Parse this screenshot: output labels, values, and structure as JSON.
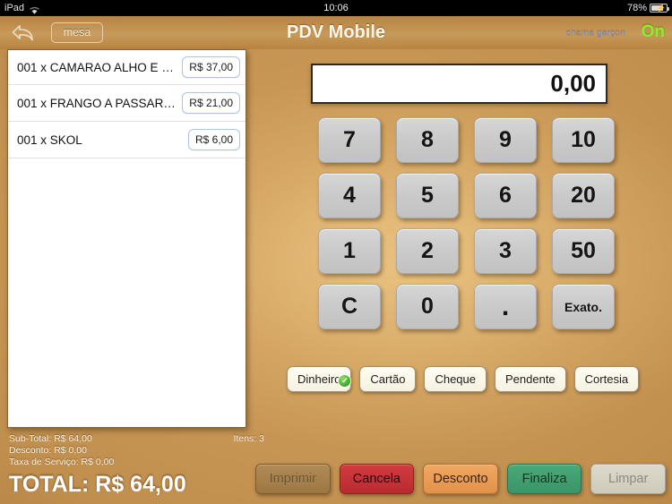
{
  "status_bar": {
    "device": "iPad",
    "wifi_icon": "wifi-icon",
    "time": "10:06",
    "battery_percent": "78%",
    "battery_icon": "battery-charging-icon"
  },
  "nav_bar": {
    "back_icon": "back-arrow-icon",
    "mesa_label": "mesa",
    "title": "PDV Mobile",
    "call_waiter_label": "chama garçon",
    "call_waiter_state": "On"
  },
  "order_list": {
    "rows": [
      {
        "label": "001 x CAMARAO ALHO E O…",
        "price": "R$ 37,00"
      },
      {
        "label": "001 x FRANGO A PASSARI…",
        "price": "R$ 21,00"
      },
      {
        "label": "001 x SKOL",
        "price": "R$ 6,00"
      }
    ]
  },
  "totals": {
    "sub_total": "Sub-Total: R$ 64,00",
    "desconto": "Desconto: R$ 0,00",
    "taxa_servico": "Taxa de Serviço: R$ 0,00",
    "items": "Itens: 3",
    "grand_total": "TOTAL: R$ 64,00"
  },
  "display": {
    "value": "0,00"
  },
  "keypad": {
    "keys": [
      {
        "label": "7",
        "style": "num"
      },
      {
        "label": "8",
        "style": "num"
      },
      {
        "label": "9",
        "style": "num"
      },
      {
        "label": "10",
        "style": "num"
      },
      {
        "label": "4",
        "style": "num"
      },
      {
        "label": "5",
        "style": "num"
      },
      {
        "label": "6",
        "style": "num"
      },
      {
        "label": "20",
        "style": "num"
      },
      {
        "label": "1",
        "style": "num"
      },
      {
        "label": "2",
        "style": "num"
      },
      {
        "label": "3",
        "style": "num"
      },
      {
        "label": "50",
        "style": "num"
      },
      {
        "label": "C",
        "style": "num"
      },
      {
        "label": "0",
        "style": "num"
      },
      {
        "label": ".",
        "style": "dot"
      },
      {
        "label": "Exato.",
        "style": "small"
      }
    ]
  },
  "payment_methods": [
    {
      "label": "Dinheiro",
      "selected": true,
      "check_icon": "check-circle-icon"
    },
    {
      "label": "Cartão",
      "selected": false
    },
    {
      "label": "Cheque",
      "selected": false
    },
    {
      "label": "Pendente",
      "selected": false
    },
    {
      "label": "Cortesia",
      "selected": false
    }
  ],
  "actions": [
    {
      "label": "Imprimir",
      "variant": "imprimir"
    },
    {
      "label": "Cancela",
      "variant": "cancela"
    },
    {
      "label": "Desconto",
      "variant": "desconto"
    },
    {
      "label": "Finaliza",
      "variant": "finaliza"
    },
    {
      "label": "Limpar",
      "variant": "limpar"
    }
  ],
  "colors": {
    "background": "#c08f4e",
    "navbar": "#b98240",
    "accent_green": "#8cf027",
    "cancel_red": "#d13b40",
    "finalize_green": "#4aa979",
    "discount_orange": "#f0a862",
    "price_badge_border": "#a9c6e6"
  }
}
